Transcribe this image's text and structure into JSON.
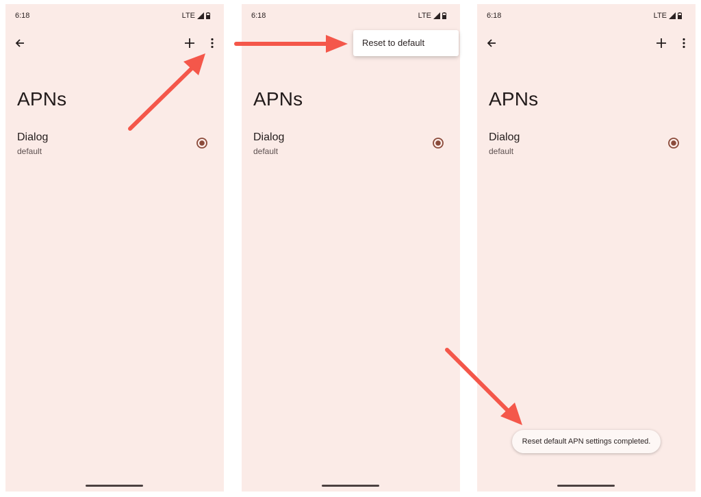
{
  "colors": {
    "screen_background": "#fbebe7",
    "arrow": "#f4574a",
    "radio": "#8a4a3a",
    "text": "#221b1b"
  },
  "screens": [
    {
      "status": {
        "time": "6:18",
        "network": "LTE"
      },
      "toolbar": {
        "back_icon": "arrow-back",
        "add_icon": "plus",
        "more_icon": "more-vertical"
      },
      "title": "APNs",
      "apn": {
        "name": "Dialog",
        "type": "default",
        "selected": true
      }
    },
    {
      "status": {
        "time": "6:18",
        "network": "LTE"
      },
      "menu": {
        "items": [
          "Reset to default"
        ]
      },
      "title": "APNs",
      "apn": {
        "name": "Dialog",
        "type": "default",
        "selected": true
      }
    },
    {
      "status": {
        "time": "6:18",
        "network": "LTE"
      },
      "toolbar": {
        "back_icon": "arrow-back",
        "add_icon": "plus",
        "more_icon": "more-vertical"
      },
      "title": "APNs",
      "apn": {
        "name": "Dialog",
        "type": "default",
        "selected": true
      },
      "toast": "Reset default APN settings completed."
    }
  ],
  "annotations": {
    "arrow_count": 3
  }
}
